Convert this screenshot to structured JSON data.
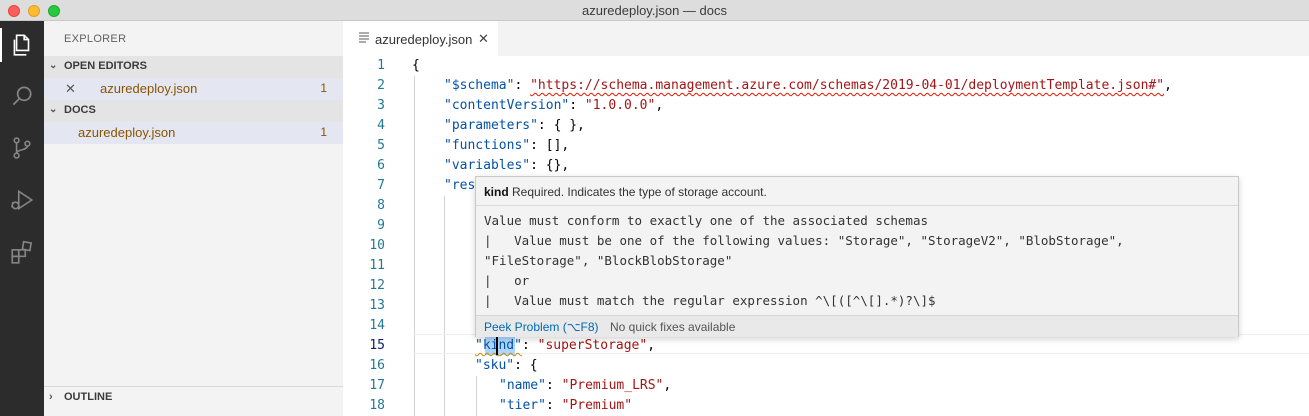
{
  "window": {
    "title": "azuredeploy.json — docs"
  },
  "activity_bar": {
    "items": [
      {
        "name": "explorer-icon"
      },
      {
        "name": "search-icon"
      },
      {
        "name": "source-control-icon"
      },
      {
        "name": "run-debug-icon"
      },
      {
        "name": "extensions-icon"
      }
    ]
  },
  "sidebar": {
    "title": "EXPLORER",
    "open_editors": {
      "header": "OPEN EDITORS",
      "files": [
        {
          "name": "azuredeploy.json",
          "problems": "1"
        }
      ]
    },
    "docs": {
      "header": "DOCS",
      "files": [
        {
          "name": "azuredeploy.json",
          "problems": "1"
        }
      ]
    },
    "outline": {
      "header": "OUTLINE"
    }
  },
  "editor": {
    "tab": {
      "label": "azuredeploy.json"
    },
    "line_numbers": [
      "1",
      "2",
      "3",
      "4",
      "5",
      "6",
      "7",
      "8",
      "9",
      "10",
      "11",
      "12",
      "13",
      "14",
      "15",
      "16",
      "17",
      "18"
    ],
    "code": {
      "l1_open": "{",
      "l2_key": "\"$schema\"",
      "l2_colon": ": ",
      "l2_val": "\"https://schema.management.azure.com/schemas/2019-04-01/deploymentTemplate.json#\"",
      "l2_end": ",",
      "l3_key": "\"contentVersion\"",
      "l3_rest": ": ",
      "l3_val": "\"1.0.0.0\"",
      "l3_end": ",",
      "l4_key": "\"parameters\"",
      "l4_rest": ": { },",
      "l5_key": "\"functions\"",
      "l5_rest": ": [],",
      "l6_key": "\"variables\"",
      "l6_rest": ": {},",
      "l7_key": "\"res",
      "l15_key_a": "\"ki",
      "l15_key_b": "nd\"",
      "l15_colon": ": ",
      "l15_val": "\"superStorage\"",
      "l15_end": ",",
      "l16_key": "\"sku\"",
      "l16_rest": ": {",
      "l17_key": "\"name\"",
      "l17_colon": ": ",
      "l17_val": "\"Premium_LRS\"",
      "l17_end": ",",
      "l18_key": "\"tier\"",
      "l18_colon": ": ",
      "l18_val": "\"Premium\""
    }
  },
  "hover": {
    "property": "kind",
    "description": " Required. Indicates the type of storage account.",
    "body": [
      "Value must conform to exactly one of the associated schemas",
      "|   Value must be one of the following values: \"Storage\", \"StorageV2\", \"BlobStorage\",",
      "\"FileStorage\", \"BlockBlobStorage\"",
      "|   or",
      "|   Value must match the regular expression ^\\[([^\\[].*)?\\]$"
    ],
    "peek_label": "Peek Problem (⌥F8)",
    "no_fix_label": "No quick fixes available"
  }
}
